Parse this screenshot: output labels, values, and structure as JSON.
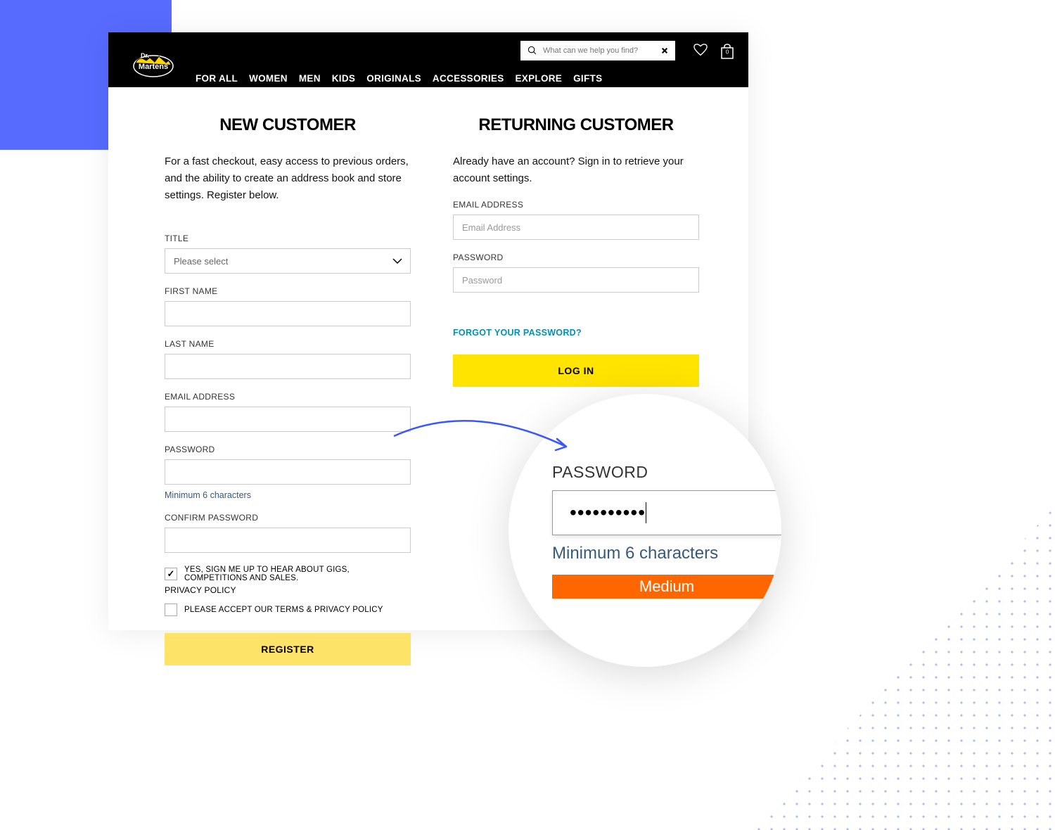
{
  "header": {
    "search_placeholder": "What can we help you find?",
    "bag_count": "0",
    "nav": [
      "FOR ALL",
      "WOMEN",
      "MEN",
      "KIDS",
      "ORIGINALS",
      "ACCESSORIES",
      "EXPLORE",
      "GIFTS"
    ]
  },
  "new_customer": {
    "title": "NEW CUSTOMER",
    "desc": "For a fast checkout, easy access to previous orders, and the ability to create an address book and store settings. Register below.",
    "fields": {
      "title": {
        "label": "TITLE",
        "placeholder": "Please select"
      },
      "first_name": {
        "label": "FIRST NAME"
      },
      "last_name": {
        "label": "LAST NAME"
      },
      "email": {
        "label": "EMAIL ADDRESS"
      },
      "password": {
        "label": "PASSWORD",
        "hint": "Minimum 6 characters"
      },
      "confirm_password": {
        "label": "CONFIRM PASSWORD"
      }
    },
    "checkbox_signup": "YES, SIGN ME UP TO HEAR ABOUT GIGS, COMPETITIONS AND SALES.",
    "privacy_policy": "PRIVACY POLICY",
    "checkbox_terms": "PLEASE ACCEPT OUR TERMS & PRIVACY POLICY",
    "register_btn": "REGISTER"
  },
  "returning_customer": {
    "title": "RETURNING CUSTOMER",
    "desc": "Already have an account? Sign in to retrieve your account settings.",
    "fields": {
      "email": {
        "label": "EMAIL ADDRESS",
        "placeholder": "Email Address"
      },
      "password": {
        "label": "PASSWORD",
        "placeholder": "Password"
      }
    },
    "forgot": "FORGOT YOUR PASSWORD?",
    "login_btn": "LOG IN"
  },
  "zoom": {
    "label": "PASSWORD",
    "dots": "••••••••••",
    "hint": "Minimum 6 characters",
    "strength": "Medium"
  }
}
